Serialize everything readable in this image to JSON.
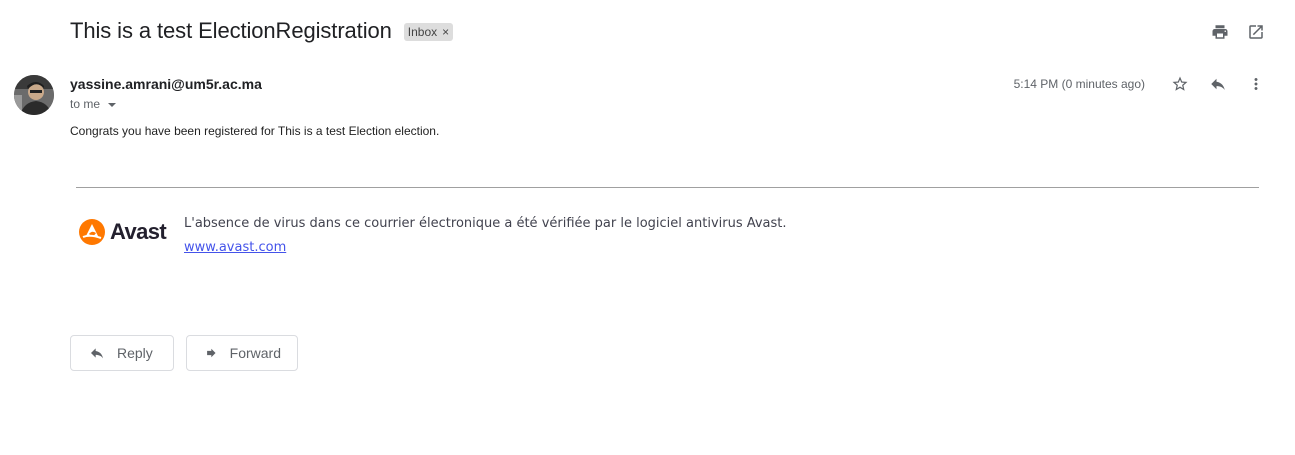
{
  "email": {
    "subject": "This is a test ElectionRegistration",
    "label": "Inbox",
    "label_close": "×",
    "sender": "yassine.amrani@um5r.ac.ma",
    "recipient": "to me",
    "time": "5:14 PM (0 minutes ago)",
    "body": "Congrats you have been registered for This is a test Election election."
  },
  "signature": {
    "brand": "Avast",
    "message": "L'absence de virus dans ce courrier électronique a été vérifiée par le logiciel antivirus Avast.",
    "link": "www.avast.com",
    "brand_color": "#ff7800"
  },
  "actions": {
    "reply": "Reply",
    "forward": "Forward"
  },
  "icons": {
    "print": "print-icon",
    "open_new_window": "open-in-new-window-icon",
    "star": "star-icon",
    "reply": "reply-icon",
    "more": "more-vertical-icon",
    "forward": "forward-icon"
  }
}
